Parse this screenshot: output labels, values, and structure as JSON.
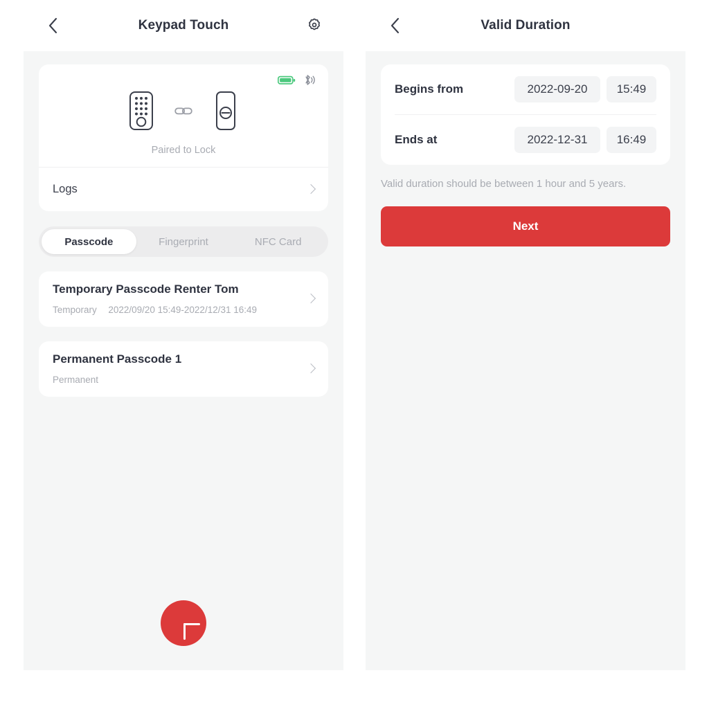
{
  "theme": {
    "accent_red": "#DC3A3A",
    "battery_green": "#4CC97E",
    "page_bg": "#F5F6F6",
    "card_bg": "#FFFFFF",
    "text_dark": "#2F3340",
    "text_muted": "#A8ABB2"
  },
  "left_panel": {
    "nav": {
      "back_icon": "chevron-left-icon",
      "title": "Keypad Touch",
      "settings_icon": "gear-icon"
    },
    "device": {
      "battery_icon": "battery-full-icon",
      "bluetooth_icon": "bluetooth-signal-icon",
      "keypad_icon": "keypad-device-icon",
      "link_icon": "link-chain-icon",
      "lock_icon": "lock-device-icon",
      "status_text": "Paired to Lock"
    },
    "logs": {
      "label": "Logs",
      "chevron_icon": "chevron-right-icon"
    },
    "tabs": [
      {
        "label": "Passcode",
        "active": true
      },
      {
        "label": "Fingerprint",
        "active": false
      },
      {
        "label": "NFC Card",
        "active": false
      }
    ],
    "passcodes": [
      {
        "title": "Temporary Passcode Renter Tom",
        "type": "Temporary",
        "period": "2022/09/20 15:49-2022/12/31 16:49",
        "chevron_icon": "chevron-right-icon"
      },
      {
        "title": "Permanent Passcode 1",
        "type": "Permanent",
        "period": "",
        "chevron_icon": "chevron-right-icon"
      }
    ],
    "fab": {
      "icon": "plus-icon",
      "label": "+"
    }
  },
  "right_panel": {
    "nav": {
      "back_icon": "chevron-left-icon",
      "title": "Valid Duration"
    },
    "form": {
      "rows": [
        {
          "label": "Begins from",
          "date": "2022-09-20",
          "time": "15:49"
        },
        {
          "label": "Ends at",
          "date": "2022-12-31",
          "time": "16:49"
        }
      ],
      "hint": "Valid duration should be between 1 hour and 5 years.",
      "submit_label": "Next"
    }
  }
}
